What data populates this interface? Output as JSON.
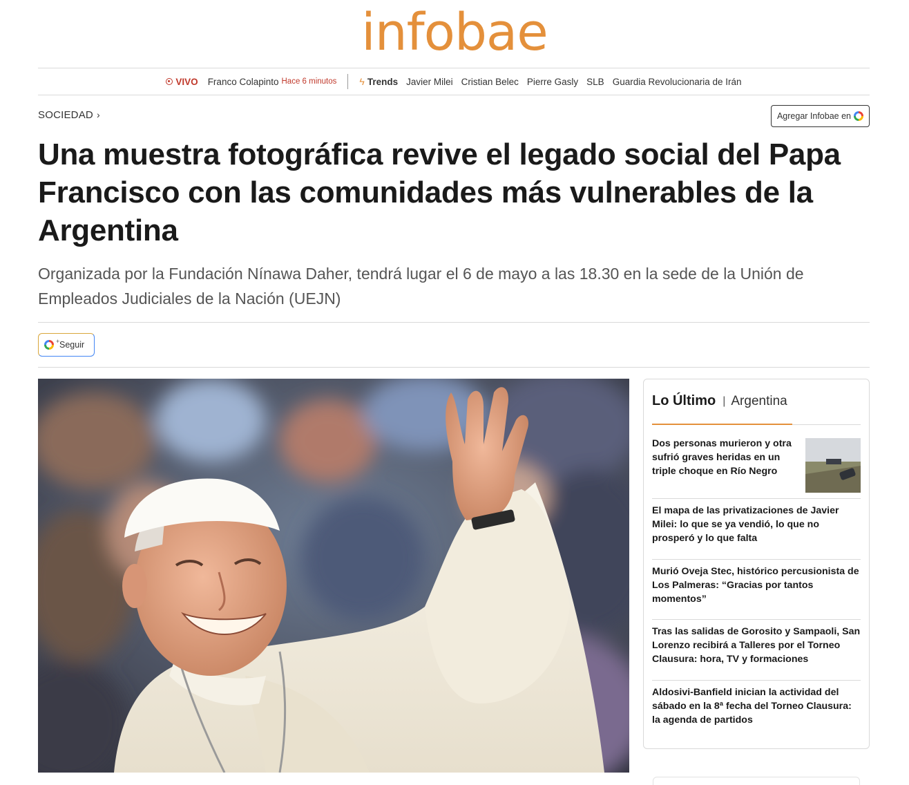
{
  "brand": {
    "logo_text": "infobae",
    "accent_color": "#e4903b",
    "live_color": "#c0392b"
  },
  "trendbar": {
    "live_label": "VIVO",
    "live_topic": "Franco Colapinto",
    "live_time": "Hace 6 minutos",
    "trends_label": "Trends",
    "trends": [
      "Javier Milei",
      "Cristian Belec",
      "Pierre Gasly",
      "SLB",
      "Guardia Revolucionaria de Irán"
    ]
  },
  "section": {
    "label": "SOCIEDAD"
  },
  "add_button": {
    "label": "Agregar Infobae en"
  },
  "article": {
    "headline": "Una muestra fotográfica revive el legado social del Papa Francisco con las comunidades más vulnerables de la Argentina",
    "subtitle": "Organizada por la Fundación Nínawa Daher, tendrá lugar el 6 de mayo a las 18.30 en la sede de la Unión de Empleados Judiciales de la Nación (UEJN)",
    "follow_label": "Seguir"
  },
  "sidebar": {
    "title": "Lo Último",
    "tab": "Argentina",
    "items": [
      {
        "title": "Dos personas murieron y otra sufrió graves heridas en un triple choque en Río Negro"
      },
      {
        "title": "El mapa de las privatizaciones de Javier Milei: lo que se ya vendió, lo que no prosperó y lo que falta"
      },
      {
        "title": "Murió Oveja Stec, histórico percusionista de Los Palmeras: “Gracias por tantos momentos”"
      },
      {
        "title": "Tras las salidas de Gorosito y Sampaoli, San Lorenzo recibirá a Talleres por el Torneo Clausura: hora, TV y formaciones"
      },
      {
        "title": "Aldosivi-Banfield inician la actividad del sábado en la 8ª fecha del Torneo Clausura: la agenda de partidos"
      }
    ]
  }
}
